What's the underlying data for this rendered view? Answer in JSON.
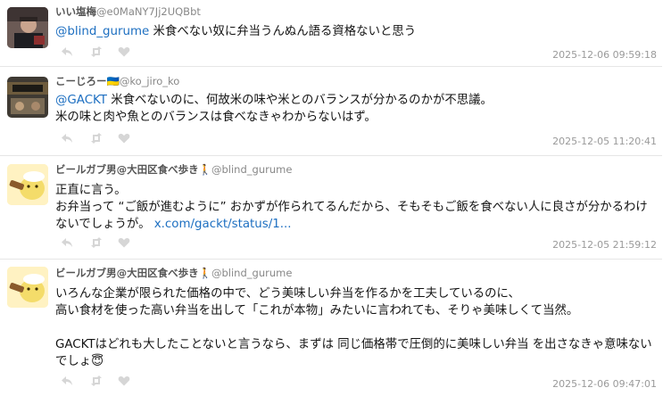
{
  "tweets": [
    {
      "name": "いい塩梅",
      "handle": "@e0MaNY7Jj2UQBbt",
      "mention": "@blind_gurume",
      "text": " 米食べない奴に弁当うんぬん語る資格ないと思う",
      "time": "2025-12-06 09:59:18"
    },
    {
      "name": "こーじろー🇺🇦",
      "handle": "@ko_jiro_ko",
      "mention": "@GACKT",
      "text": " 米食べないのに、何故米の味や米とのバランスが分かるのかが不思議。\n米の味と肉や魚とのバランスは食べなきゃわからないはず。",
      "time": "2025-12-05 11:20:41"
    },
    {
      "name": "ビールガブ男@大田区食べ歩き🚶",
      "handle": "@blind_gurume",
      "text": "正直に言う。\nお弁当って “ご飯が進むように” おかずが作られてるんだから、そもそもご飯を食べない人に良さが分かるわけないでしょうが。 ",
      "link": "x.com/gackt/status/1...",
      "time": "2025-12-05 21:59:12"
    },
    {
      "name": "ビールガブ男@大田区食べ歩き🚶",
      "handle": "@blind_gurume",
      "text": "いろんな企業が限られた価格の中で、どう美味しい弁当を作るかを工夫しているのに、\n高い食材を使った高い弁当を出して「これが本物」みたいに言われても、そりゃ美味しくて当然。\n\nGACKTはどれも大したことないと言うなら、まずは 同じ価格帯で圧倒的に美味しい弁当 を出さなきゃ意味ないでしょ😇",
      "time": "2025-12-06 09:47:01"
    }
  ],
  "icons": [
    "reply-icon",
    "retweet-icon",
    "like-icon"
  ],
  "colors": {
    "link": "#1d6fc1",
    "muted": "#9a9a9a",
    "separator": "#e6e6e6",
    "avatar_bg": "#fff2c2"
  }
}
